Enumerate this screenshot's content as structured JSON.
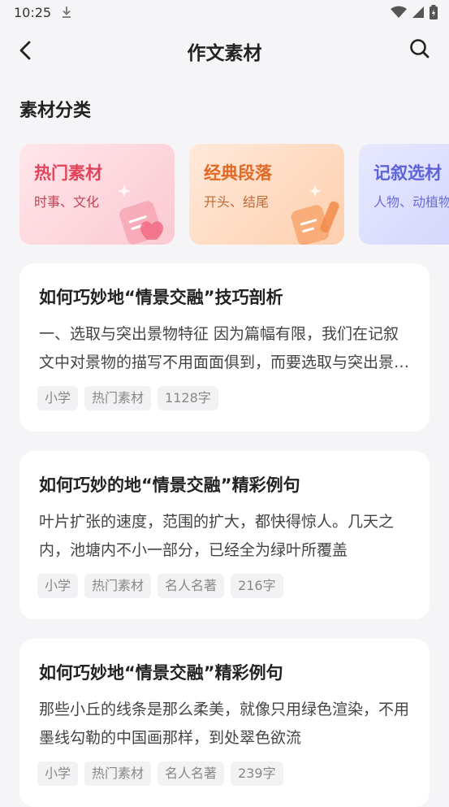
{
  "status_bar": {
    "time": "10:25"
  },
  "header": {
    "title": "作文素材"
  },
  "section": {
    "title": "素材分类"
  },
  "categories": [
    {
      "title": "热门素材",
      "subtitle": "时事、文化"
    },
    {
      "title": "经典段落",
      "subtitle": "开头、结尾"
    },
    {
      "title": "记叙选材",
      "subtitle": "人物、动植物"
    }
  ],
  "articles": [
    {
      "title": "如何巧妙地“情景交融”技巧剖析",
      "excerpt": "一、选取与突出景物特征  因为篇幅有限，我们在记叙文中对景物的描写不用面面俱到，而要选取与突出景物特征",
      "tags": [
        "小学",
        "热门素材",
        "1128字"
      ]
    },
    {
      "title": "如何巧妙的地“情景交融”精彩例句",
      "excerpt": "叶片扩张的速度，范围的扩大，都快得惊人。几天之内，池塘内不小一部分，已经全为绿叶所覆盖",
      "tags": [
        "小学",
        "热门素材",
        "名人名著",
        "216字"
      ]
    },
    {
      "title": "如何巧妙地“情景交融”精彩例句",
      "excerpt": "那些小丘的线条是那么柔美，就像只用绿色渲染，不用墨线勾勒的中国画那样，到处翠色欲流",
      "tags": [
        "小学",
        "热门素材",
        "名人名著",
        "239字"
      ]
    }
  ]
}
